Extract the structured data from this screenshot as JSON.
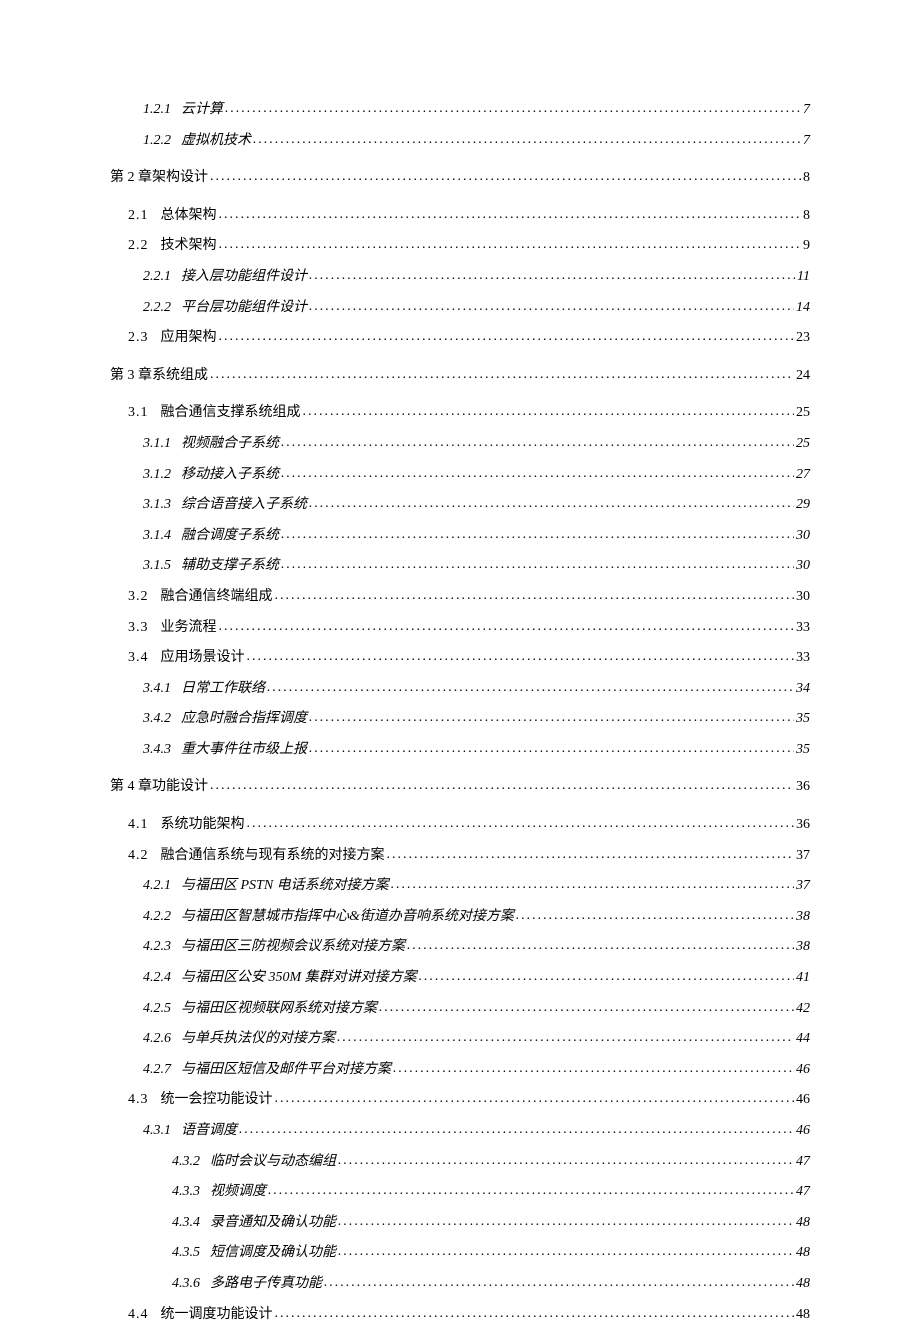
{
  "entries": [
    {
      "level": "level-2 italic-sub",
      "num": "1.2.1",
      "label": "云计算",
      "page": "7"
    },
    {
      "level": "level-2 italic-sub",
      "num": "1.2.2",
      "label": "虚拟机技术",
      "page": "7"
    },
    {
      "level": "level-0 chapter-row",
      "num": "",
      "label": "第 2 章架构设计",
      "page": "8"
    },
    {
      "level": "level-1",
      "num": "2.1",
      "label": "总体架构",
      "page": "8"
    },
    {
      "level": "level-1",
      "num": "2.2",
      "label": "技术架构",
      "page": "9"
    },
    {
      "level": "level-2 italic-sub",
      "num": "2.2.1",
      "label": "接入层功能组件设计",
      "page": "11"
    },
    {
      "level": "level-2 italic-sub",
      "num": "2.2.2",
      "label": "平台层功能组件设计",
      "page": "14"
    },
    {
      "level": "level-1",
      "num": "2.3",
      "label": "应用架构",
      "page": "23"
    },
    {
      "level": "level-0 chapter-row",
      "num": "",
      "label": "第 3 章系统组成",
      "page": "24"
    },
    {
      "level": "level-1",
      "num": "3.1",
      "label": "融合通信支撑系统组成",
      "page": "25"
    },
    {
      "level": "level-2 italic-sub",
      "num": "3.1.1",
      "label": "视频融合子系统",
      "page": "25"
    },
    {
      "level": "level-2 italic-sub",
      "num": "3.1.2",
      "label": "移动接入子系统",
      "page": "27"
    },
    {
      "level": "level-2 italic-sub",
      "num": "3.1.3",
      "label": "综合语音接入子系统",
      "page": "29"
    },
    {
      "level": "level-2 italic-sub",
      "num": "3.1.4",
      "label": "融合调度子系统",
      "page": "30"
    },
    {
      "level": "level-2 italic-sub",
      "num": "3.1.5",
      "label": "辅助支撑子系统",
      "page": "30"
    },
    {
      "level": "level-1",
      "num": "3.2",
      "label": "融合通信终端组成",
      "page": "30"
    },
    {
      "level": "level-1",
      "num": "3.3",
      "label": "业务流程",
      "page": "33"
    },
    {
      "level": "level-1",
      "num": "3.4",
      "label": "应用场景设计",
      "page": "33"
    },
    {
      "level": "level-2 italic-sub",
      "num": "3.4.1",
      "label": "日常工作联络",
      "page": "34"
    },
    {
      "level": "level-2 italic-sub",
      "num": "3.4.2",
      "label": "应急时融合指挥调度",
      "page": "35"
    },
    {
      "level": "level-2 italic-sub",
      "num": "3.4.3",
      "label": "重大事件往市级上报",
      "page": "35"
    },
    {
      "level": "level-0 chapter-row",
      "num": "",
      "label": "第 4 章功能设计",
      "page": "36"
    },
    {
      "level": "level-1",
      "num": "4.1",
      "label": "系统功能架构",
      "page": "36"
    },
    {
      "level": "level-1",
      "num": "4.2",
      "label": "融合通信系统与现有系统的对接方案",
      "page": "37"
    },
    {
      "level": "level-2 italic-sub",
      "num": "4.2.1",
      "label": "与福田区 PSTN 电话系统对接方案",
      "page": "37"
    },
    {
      "level": "level-2 italic-sub",
      "num": "4.2.2",
      "label": "与福田区智慧城市指挥中心&街道办音响系统对接方案",
      "page": "38"
    },
    {
      "level": "level-2 italic-sub",
      "num": "4.2.3",
      "label": "与福田区三防视频会议系统对接方案",
      "page": "38"
    },
    {
      "level": "level-2 italic-sub",
      "num": "4.2.4",
      "label": "与福田区公安 350M 集群对讲对接方案",
      "page": "41"
    },
    {
      "level": "level-2 italic-sub",
      "num": "4.2.5",
      "label": "与福田区视频联网系统对接方案",
      "page": "42"
    },
    {
      "level": "level-2 italic-sub",
      "num": "4.2.6",
      "label": "与单兵执法仪的对接方案",
      "page": "44"
    },
    {
      "level": "level-2 italic-sub",
      "num": "4.2.7",
      "label": "与福田区短信及邮件平台对接方案",
      "page": "46"
    },
    {
      "level": "level-1",
      "num": "4.3",
      "label": "统一会控功能设计",
      "page": "46"
    },
    {
      "level": "level-2 italic-sub",
      "num": "4.3.1",
      "label": "语音调度",
      "page": "46"
    },
    {
      "level": "level-2b italic-sub",
      "num": "4.3.2",
      "label": "临时会议与动态编组",
      "page": "47"
    },
    {
      "level": "level-2b italic-sub",
      "num": "4.3.3",
      "label": "视频调度",
      "page": "47"
    },
    {
      "level": "level-2b italic-sub",
      "num": "4.3.4",
      "label": "录音通知及确认功能",
      "page": "48"
    },
    {
      "level": "level-2b italic-sub",
      "num": "4.3.5",
      "label": "短信调度及确认功能",
      "page": "48"
    },
    {
      "level": "level-2b italic-sub",
      "num": "4.3.6",
      "label": "多路电子传真功能",
      "page": "48"
    },
    {
      "level": "level-1",
      "num": "4.4",
      "label": "统一调度功能设计",
      "page": "48"
    }
  ]
}
